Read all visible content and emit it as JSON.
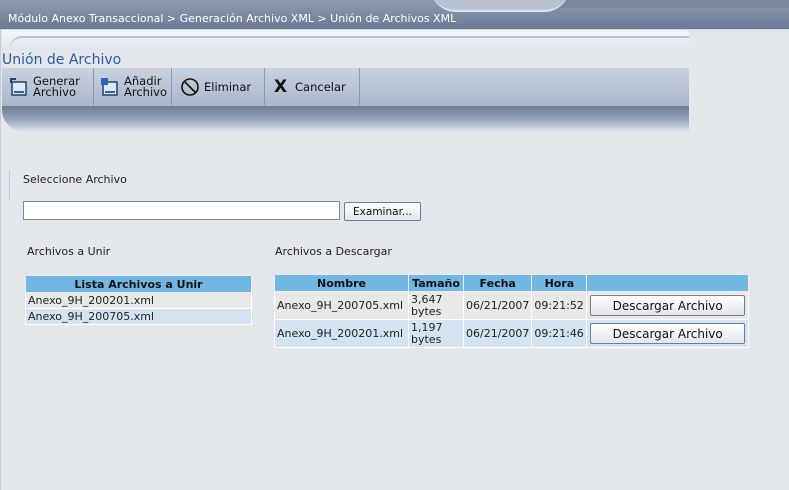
{
  "breadcrumb": "Módulo Anexo Transaccional > Generación Archivo XML > Unión de Archivos XML",
  "page_title": "Unión de Archivo",
  "toolbar": {
    "generate": {
      "line1": "Generar",
      "line2": "Archivo",
      "icon": "generate-file-icon"
    },
    "add": {
      "line1": "Añadir",
      "line2": "Archivo",
      "icon": "add-file-icon"
    },
    "delete": {
      "label": "Eliminar",
      "icon": "prohibited-icon"
    },
    "cancel": {
      "label": "Cancelar",
      "icon": "x-icon"
    }
  },
  "select_file": {
    "label": "Seleccione Archivo",
    "value": "",
    "browse_label": "Examinar..."
  },
  "files_to_join": {
    "section_label": "Archivos a Unir",
    "header": "Lista Archivos a Unir",
    "items": [
      "Anexo_9H_200201.xml",
      "Anexo_9H_200705.xml"
    ]
  },
  "files_to_download": {
    "section_label": "Archivos a Descargar",
    "columns": [
      "Nombre",
      "Tamaño",
      "Fecha",
      "Hora",
      ""
    ],
    "rows": [
      {
        "name": "Anexo_9H_200705.xml",
        "size_num": "3,647",
        "size_unit": "bytes",
        "date": "06/21/2007",
        "time": "09:21:52",
        "action": "Descargar Archivo"
      },
      {
        "name": "Anexo_9H_200201.xml",
        "size_num": "1,197",
        "size_unit": "bytes",
        "date": "06/21/2007",
        "time": "09:21:46",
        "action": "Descargar Archivo"
      }
    ]
  },
  "colors": {
    "accent": "#72b7e3",
    "title": "#2a5aa0",
    "row_alt": "#d4e3f1"
  }
}
